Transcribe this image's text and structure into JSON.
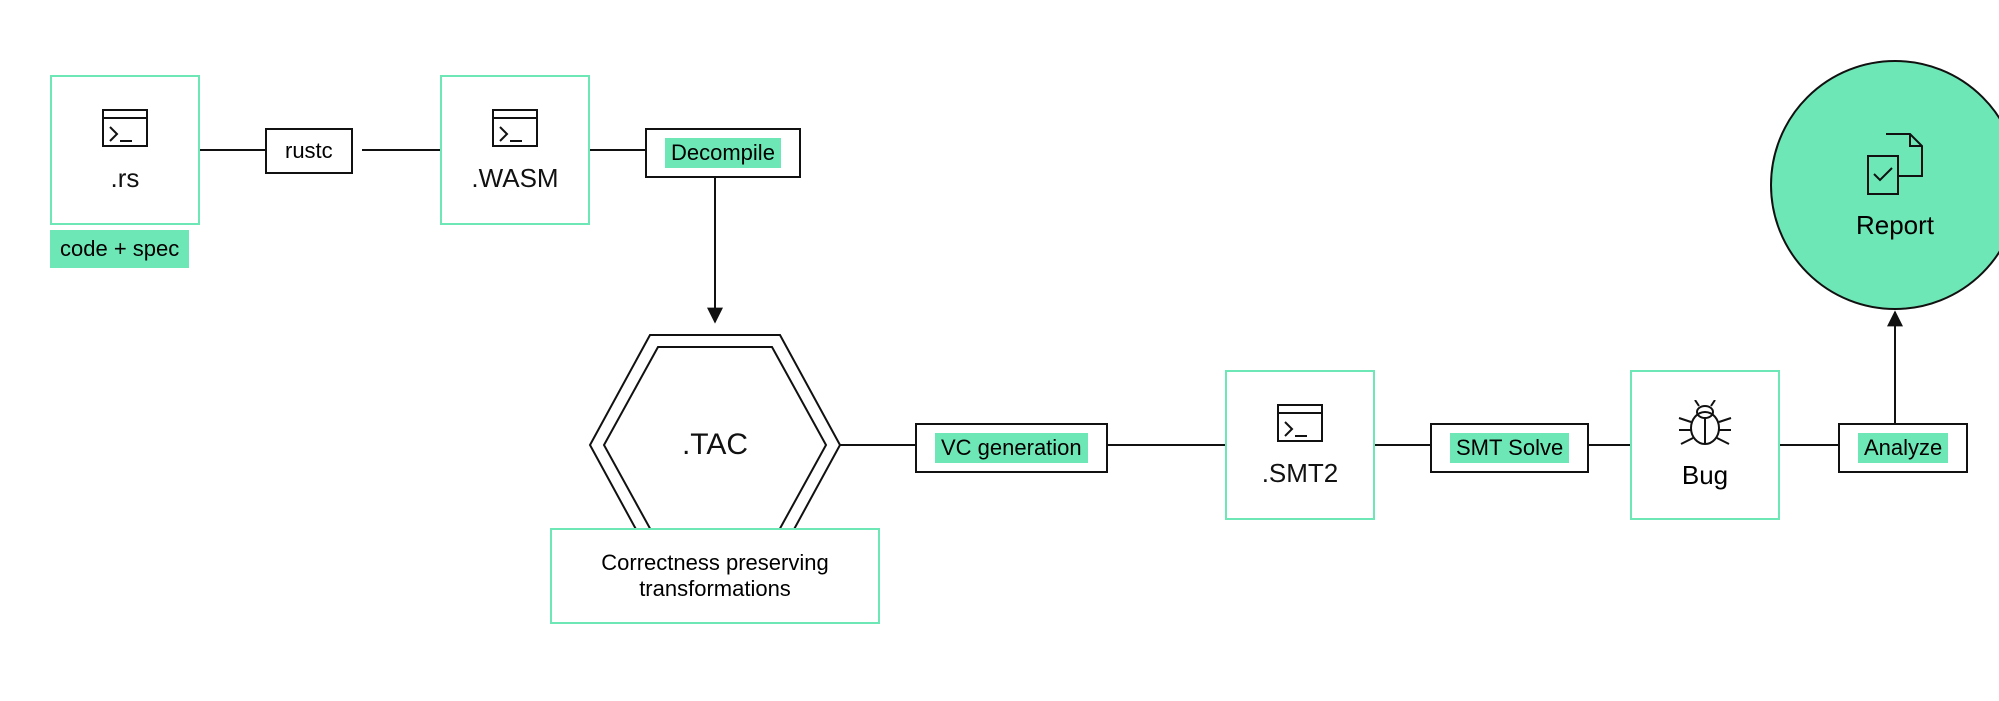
{
  "nodes": {
    "rs": {
      "ext": ".rs",
      "note": "code + spec"
    },
    "rustc": {
      "label": "rustc"
    },
    "wasm": {
      "ext": ".WASM"
    },
    "decompile": {
      "label": "Decompile"
    },
    "tac": {
      "label": ".TAC",
      "note": "Correctness preserving transformations"
    },
    "vcgen": {
      "label": "VC generation"
    },
    "smt2": {
      "ext": ".SMT2"
    },
    "smtsolve": {
      "label": "SMT Solve"
    },
    "bug": {
      "label": "Bug"
    },
    "analyze": {
      "label": "Analyze"
    },
    "report": {
      "label": "Report"
    }
  }
}
